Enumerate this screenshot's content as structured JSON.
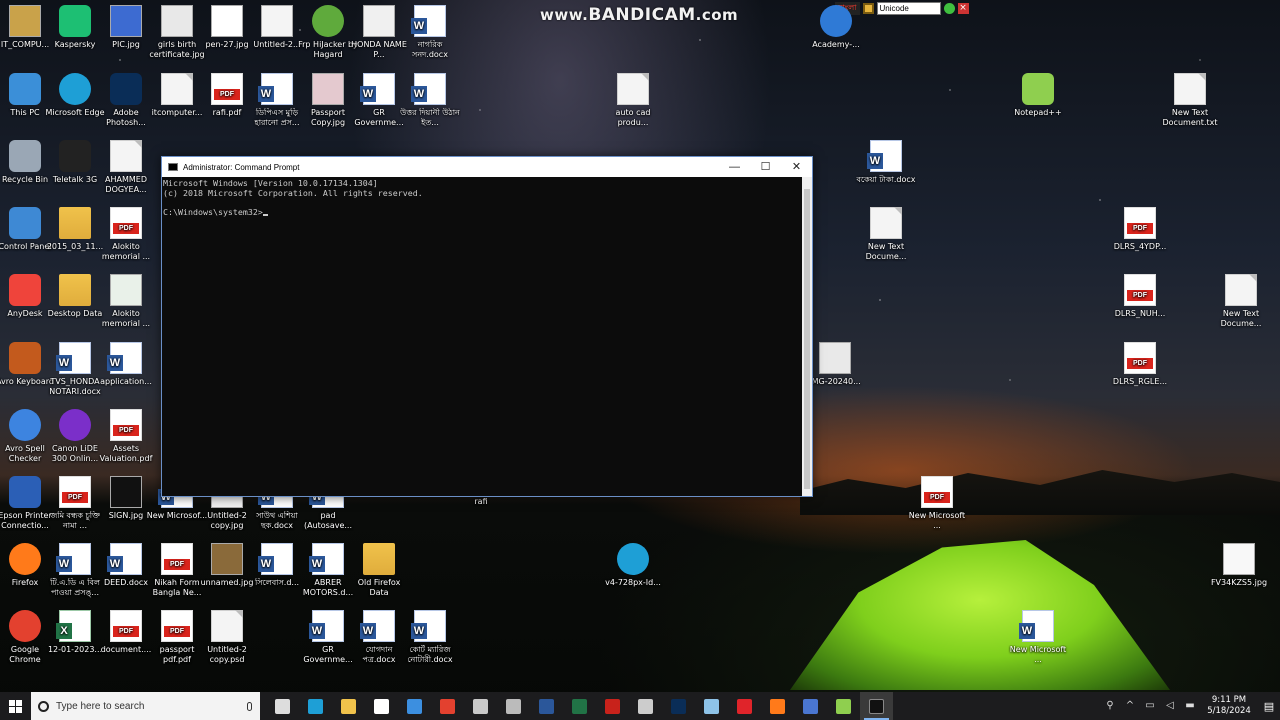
{
  "watermark": {
    "prefix": "www.",
    "brand": "BANDICAM",
    "suffix": ".com"
  },
  "avro_bar": {
    "mode_label": "বাংলা",
    "layout_select": "Unicode"
  },
  "desktop_icons": [
    {
      "label": "IT_COMPU...",
      "kind": "img",
      "color": "#c9a24a"
    },
    {
      "label": "Kaspersky",
      "kind": "app",
      "color": "#1dbf73"
    },
    {
      "label": "PIC.jpg",
      "kind": "img",
      "color": "#3d6bd1"
    },
    {
      "label": "girls birth certificate.jpg",
      "kind": "img",
      "color": "#e8e8e8"
    },
    {
      "label": "pen-27.jpg",
      "kind": "img",
      "color": "#ffffff"
    },
    {
      "label": "Untitled-2...",
      "kind": "img",
      "color": "#f4f4f4"
    },
    {
      "label": "Frp HiJacker by Hagard",
      "kind": "round",
      "color": "#5faa3c"
    },
    {
      "label": "HONDA NAME P...",
      "kind": "img",
      "color": "#f0f0f0"
    },
    {
      "label": "নাগরিক সনদ.docx",
      "kind": "word",
      "color": "#2b579a"
    },
    {
      "label": "Academy-...",
      "kind": "round",
      "color": "#2f7ad6"
    },
    {
      "label": "This PC",
      "kind": "app",
      "color": "#3b8fd8"
    },
    {
      "label": "Microsoft Edge",
      "kind": "round",
      "color": "#1e9fd6"
    },
    {
      "label": "Adobe Photosh...",
      "kind": "app",
      "color": "#0a2d57"
    },
    {
      "label": "itcomputer...",
      "kind": "doc",
      "color": "#f4f4f4"
    },
    {
      "label": "rafi.pdf",
      "kind": "pdf",
      "color": "#d9241c"
    },
    {
      "label": "ডিপিএস মুড়ি হারানো প্রস...",
      "kind": "word",
      "color": "#2b579a"
    },
    {
      "label": "Passport Copy.jpg",
      "kind": "img",
      "color": "#e4c9cf"
    },
    {
      "label": "GR Governme...",
      "kind": "word",
      "color": "#2b579a"
    },
    {
      "label": "উত্তর দিয়ানী উঠান ইত...",
      "kind": "word",
      "color": "#2b579a"
    },
    {
      "label": "auto cad produ...",
      "kind": "doc",
      "color": "#f4f4f4"
    },
    {
      "label": "Notepad++",
      "kind": "app",
      "color": "#8fcf4f"
    },
    {
      "label": "New Text Document.txt",
      "kind": "doc",
      "color": "#f4f4f4"
    },
    {
      "label": "Recycle Bin",
      "kind": "app",
      "color": "#9aa7b5"
    },
    {
      "label": "Teletalk 3G",
      "kind": "app",
      "color": "#222222"
    },
    {
      "label": "AHAMMED DOGYEA...",
      "kind": "doc",
      "color": "#f4f4f4"
    },
    {
      "label": "বকেয়া টাকা.docx",
      "kind": "word",
      "color": "#2b579a"
    },
    {
      "label": "Control Panel",
      "kind": "app",
      "color": "#3e89d4"
    },
    {
      "label": "2015_03_11...",
      "kind": "folder",
      "color": "#f0c24b"
    },
    {
      "label": "Alokito memorial ...",
      "kind": "pdf",
      "color": "#d9241c"
    },
    {
      "label": "New Text Docume...",
      "kind": "doc",
      "color": "#f4f4f4"
    },
    {
      "label": "DLRS_4YDP...",
      "kind": "pdf",
      "color": "#d9241c"
    },
    {
      "label": "AnyDesk",
      "kind": "app",
      "color": "#ef443b"
    },
    {
      "label": "Desktop Data",
      "kind": "folder",
      "color": "#f0c24b"
    },
    {
      "label": "Alokito memorial ...",
      "kind": "img",
      "color": "#e9f1e9"
    },
    {
      "label": "DLRS_NUH...",
      "kind": "pdf",
      "color": "#d9241c"
    },
    {
      "label": "New Text Docume...",
      "kind": "doc",
      "color": "#f4f4f4"
    },
    {
      "label": "Avro Keyboard",
      "kind": "app",
      "color": "#c35a1d"
    },
    {
      "label": "TVS_HONDA NOTARI.docx",
      "kind": "word",
      "color": "#2b579a"
    },
    {
      "label": "application...",
      "kind": "word",
      "color": "#2b579a"
    },
    {
      "label": "IMG-20240...",
      "kind": "img",
      "color": "#e9e9e9"
    },
    {
      "label": "DLRS_RGLE...",
      "kind": "pdf",
      "color": "#d9241c"
    },
    {
      "label": "Avro Spell Checker",
      "kind": "round",
      "color": "#3d84e0"
    },
    {
      "label": "Canon LiDE 300 Onlin...",
      "kind": "round",
      "color": "#7b2fc9"
    },
    {
      "label": "Assets Valuation.pdf",
      "kind": "pdf",
      "color": "#d9241c"
    },
    {
      "label": "Epson Printer Connectio...",
      "kind": "app",
      "color": "#2b5fb6"
    },
    {
      "label": "জমি বন্ধক চুক্তি নামা ...",
      "kind": "pdf",
      "color": "#d9241c"
    },
    {
      "label": "SIGN.jpg",
      "kind": "img",
      "color": "#111111"
    },
    {
      "label": "New Microsof...",
      "kind": "word",
      "color": "#2b579a"
    },
    {
      "label": "Untitled-2 copy.jpg",
      "kind": "img",
      "color": "#f0f0f0"
    },
    {
      "label": "সাউথ এশিয়া ছক.docx",
      "kind": "word",
      "color": "#2b579a"
    },
    {
      "label": "pad (Autosave...",
      "kind": "word",
      "color": "#2b579a"
    },
    {
      "label": "rafi",
      "kind": "img",
      "color": "#c0392b"
    },
    {
      "label": "New Microsoft ...",
      "kind": "pdf",
      "color": "#d9241c"
    },
    {
      "label": "Firefox",
      "kind": "round",
      "color": "#ff7a1a"
    },
    {
      "label": "টি.এ.ডি এ বিল পাওয়া প্রসঙ্...",
      "kind": "word",
      "color": "#2b579a"
    },
    {
      "label": "DEED.docx",
      "kind": "word",
      "color": "#2b579a"
    },
    {
      "label": "Nikah Form Bangla Ne...",
      "kind": "pdf",
      "color": "#d9241c"
    },
    {
      "label": "unnamed.jpg",
      "kind": "img",
      "color": "#8a6a3a"
    },
    {
      "label": "সিলেবাস.d...",
      "kind": "word",
      "color": "#2b579a"
    },
    {
      "label": "ABRER MOTORS.d...",
      "kind": "word",
      "color": "#2b579a"
    },
    {
      "label": "Old Firefox Data",
      "kind": "folder",
      "color": "#f0c24b"
    },
    {
      "label": "v4-728px-Id...",
      "kind": "round",
      "color": "#1e9fd6"
    },
    {
      "label": "FV34KZS5.jpg",
      "kind": "img",
      "color": "#f8f8f8"
    },
    {
      "label": "Google Chrome",
      "kind": "round",
      "color": "#e3412f"
    },
    {
      "label": "12-01-2023...",
      "kind": "excel",
      "color": "#217346"
    },
    {
      "label": "document....",
      "kind": "pdf",
      "color": "#d9241c"
    },
    {
      "label": "passport pdf.pdf",
      "kind": "pdf",
      "color": "#d9241c"
    },
    {
      "label": "Untitled-2 copy.psd",
      "kind": "doc",
      "color": "#f4f4f4"
    },
    {
      "label": "GR Governme...",
      "kind": "word",
      "color": "#2b579a"
    },
    {
      "label": "যোগদান পত্র.docx",
      "kind": "word",
      "color": "#2b579a"
    },
    {
      "label": "কোর্ট ম্যারিজ নোটারী.docx",
      "kind": "word",
      "color": "#2b579a"
    },
    {
      "label": "New Microsoft ...",
      "kind": "word",
      "color": "#2b579a"
    }
  ],
  "cmd_window": {
    "title": "Administrator: Command Prompt",
    "line1": "Microsoft Windows [Version 10.0.17134.1304]",
    "line2": "(c) 2018 Microsoft Corporation. All rights reserved.",
    "prompt": "C:\\Windows\\system32>",
    "minimize_glyph": "—",
    "maximize_glyph": "☐",
    "close_glyph": "✕"
  },
  "taskbar": {
    "search_placeholder": "Type here to search",
    "apps": [
      {
        "name": "task-view",
        "color": "#dddddd"
      },
      {
        "name": "edge",
        "color": "#1e9fd6"
      },
      {
        "name": "file-explorer",
        "color": "#f0c24b"
      },
      {
        "name": "store",
        "color": "#ffffff"
      },
      {
        "name": "mail",
        "color": "#3c8fe0"
      },
      {
        "name": "chrome",
        "color": "#e3412f"
      },
      {
        "name": "notepad",
        "color": "#c9c9c9"
      },
      {
        "name": "calculator",
        "color": "#bbbbbb"
      },
      {
        "name": "word",
        "color": "#2b579a"
      },
      {
        "name": "excel",
        "color": "#217346"
      },
      {
        "name": "acrobat",
        "color": "#c8221b"
      },
      {
        "name": "paint",
        "color": "#cccccc"
      },
      {
        "name": "photoshop",
        "color": "#0a2d57"
      },
      {
        "name": "notepad2",
        "color": "#8ec3e8"
      },
      {
        "name": "record",
        "color": "#e0242a"
      },
      {
        "name": "firefox",
        "color": "#ff7a1a"
      },
      {
        "name": "photos",
        "color": "#4a76d1"
      },
      {
        "name": "notepad-plus",
        "color": "#8fcf4f"
      },
      {
        "name": "command-prompt",
        "color": "#111111"
      }
    ],
    "time": "9:11 PM",
    "date": "5/18/2024"
  }
}
